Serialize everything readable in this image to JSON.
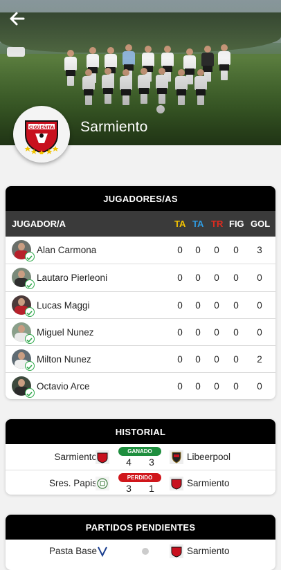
{
  "header": {
    "team_name": "Sarmiento",
    "crest_text": "CIGÜEÑITA"
  },
  "players_card": {
    "title": "JUGADORES/AS",
    "columns": {
      "player": "JUGADOR/A",
      "ta": "TA",
      "ta2": "TA",
      "tr": "TR",
      "fig": "FIG",
      "gol": "GOL"
    },
    "rows": [
      {
        "name": "Alan Carmona",
        "ta": "0",
        "ta2": "0",
        "tr": "0",
        "fig": "0",
        "gol": "3"
      },
      {
        "name": "Lautaro Pierleoni",
        "ta": "0",
        "ta2": "0",
        "tr": "0",
        "fig": "0",
        "gol": "0"
      },
      {
        "name": "Lucas Maggi",
        "ta": "0",
        "ta2": "0",
        "tr": "0",
        "fig": "0",
        "gol": "0"
      },
      {
        "name": "Miguel Nunez",
        "ta": "0",
        "ta2": "0",
        "tr": "0",
        "fig": "0",
        "gol": "0"
      },
      {
        "name": "Milton Nunez",
        "ta": "0",
        "ta2": "0",
        "tr": "0",
        "fig": "0",
        "gol": "2"
      },
      {
        "name": "Octavio Arce",
        "ta": "0",
        "ta2": "0",
        "tr": "0",
        "fig": "0",
        "gol": "0"
      }
    ]
  },
  "history_card": {
    "title": "HISTORIAL",
    "matches": [
      {
        "home": "Sarmiento",
        "away": "Libeerpool",
        "result": "GANADO",
        "home_score": "4",
        "away_score": "3"
      },
      {
        "home": "Sres. Papis",
        "away": "Sarmiento",
        "result": "PERDIDO",
        "home_score": "3",
        "away_score": "1"
      }
    ]
  },
  "pending_card": {
    "title": "PARTIDOS PENDIENTES",
    "matches": [
      {
        "home": "Pasta Base",
        "away": "Sarmiento"
      }
    ]
  },
  "colors": {
    "ta_yellow": "#f5c400",
    "ta_blue": "#2f9be0",
    "tr_red": "#e02b1f",
    "won_green": "#1e8e3e",
    "lost_red": "#d0161b"
  }
}
